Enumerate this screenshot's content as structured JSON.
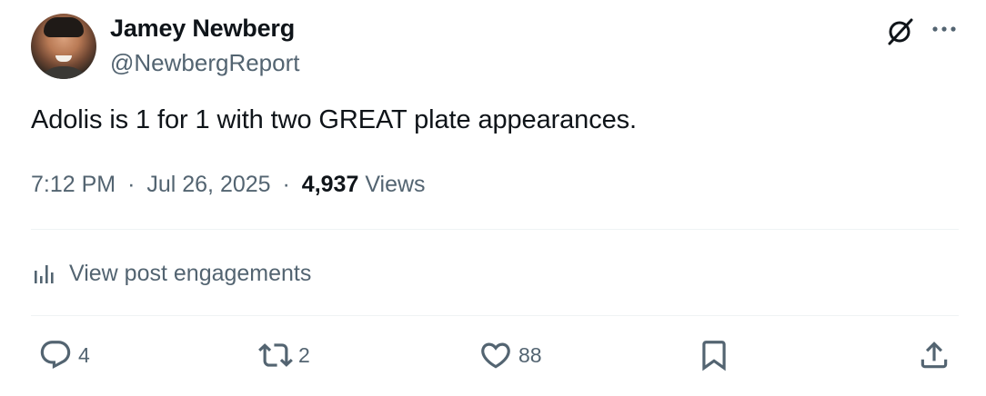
{
  "author": {
    "name": "Jamey Newberg",
    "handle": "@NewbergReport"
  },
  "post": {
    "text": "Adolis is 1 for 1 with two GREAT plate appearances.",
    "time": "7:12 PM",
    "date": "Jul 26, 2025",
    "separator": "·",
    "views_count": "4,937",
    "views_label": "Views"
  },
  "engagements_link": "View post engagements",
  "actions": {
    "replies": "4",
    "reposts": "2",
    "likes": "88"
  },
  "icons": {
    "avatar": "avatar",
    "grok": "grok-icon",
    "more": "more-icon",
    "engagements": "bar-chart-icon",
    "reply": "reply-icon",
    "repost": "repost-icon",
    "like": "heart-icon",
    "bookmark": "bookmark-icon",
    "share": "share-icon"
  },
  "colors": {
    "text_primary": "#0f1419",
    "text_secondary": "#536471",
    "divider": "#eff3f4"
  }
}
